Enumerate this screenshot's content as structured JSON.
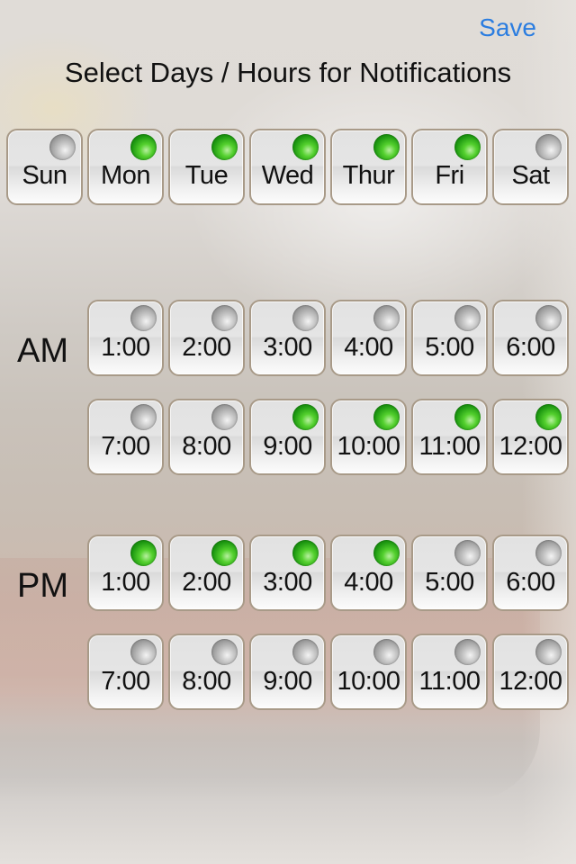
{
  "header": {
    "save_label": "Save",
    "title": "Select Days / Hours for Notifications"
  },
  "colors": {
    "accent": "#2b7de0",
    "led_on": "#22a015",
    "led_off": "#a0a0a0"
  },
  "days": [
    {
      "label": "Sun",
      "selected": false
    },
    {
      "label": "Mon",
      "selected": true
    },
    {
      "label": "Tue",
      "selected": true
    },
    {
      "label": "Wed",
      "selected": true
    },
    {
      "label": "Thur",
      "selected": true
    },
    {
      "label": "Fri",
      "selected": true
    },
    {
      "label": "Sat",
      "selected": false
    }
  ],
  "am": {
    "label": "AM",
    "hours": [
      {
        "label": "1:00",
        "selected": false
      },
      {
        "label": "2:00",
        "selected": false
      },
      {
        "label": "3:00",
        "selected": false
      },
      {
        "label": "4:00",
        "selected": false
      },
      {
        "label": "5:00",
        "selected": false
      },
      {
        "label": "6:00",
        "selected": false
      },
      {
        "label": "7:00",
        "selected": false
      },
      {
        "label": "8:00",
        "selected": false
      },
      {
        "label": "9:00",
        "selected": true
      },
      {
        "label": "10:00",
        "selected": true
      },
      {
        "label": "11:00",
        "selected": true
      },
      {
        "label": "12:00",
        "selected": true
      }
    ]
  },
  "pm": {
    "label": "PM",
    "hours": [
      {
        "label": "1:00",
        "selected": true
      },
      {
        "label": "2:00",
        "selected": true
      },
      {
        "label": "3:00",
        "selected": true
      },
      {
        "label": "4:00",
        "selected": true
      },
      {
        "label": "5:00",
        "selected": false
      },
      {
        "label": "6:00",
        "selected": false
      },
      {
        "label": "7:00",
        "selected": false
      },
      {
        "label": "8:00",
        "selected": false
      },
      {
        "label": "9:00",
        "selected": false
      },
      {
        "label": "10:00",
        "selected": false
      },
      {
        "label": "11:00",
        "selected": false
      },
      {
        "label": "12:00",
        "selected": false
      }
    ]
  }
}
